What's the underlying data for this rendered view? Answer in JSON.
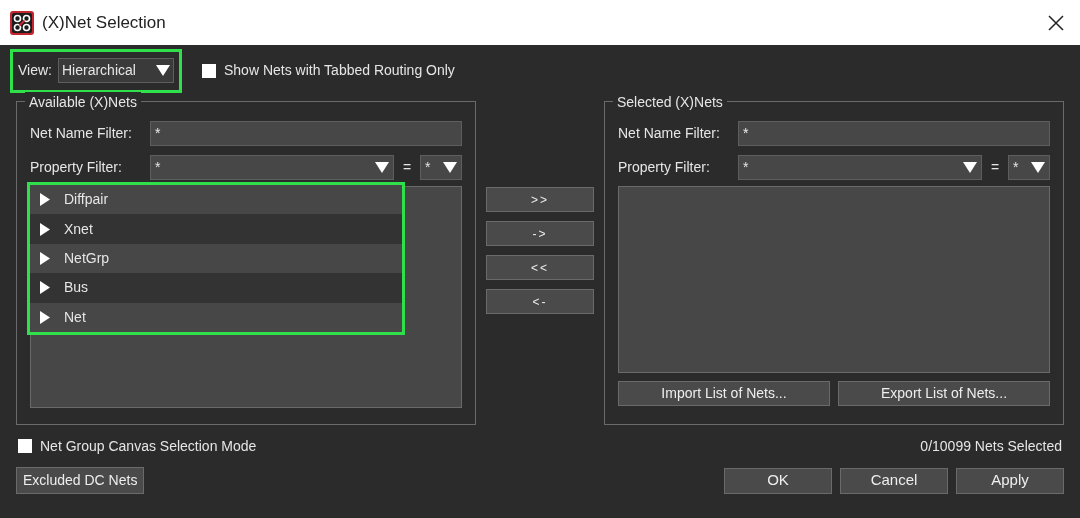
{
  "window": {
    "title": "(X)Net Selection"
  },
  "view": {
    "label": "View:",
    "value": "Hierarchical",
    "highlighted": true
  },
  "tabbed_only": {
    "label": "Show Nets with Tabbed Routing Only",
    "checked": false
  },
  "available": {
    "title": "Available (X)Nets",
    "name_filter": {
      "label": "Net Name Filter:",
      "value": "*"
    },
    "property_filter": {
      "label": "Property Filter:",
      "value": "*",
      "equals": "=",
      "value_2": "*"
    },
    "highlighted": true,
    "items": [
      {
        "label": "Diffpair",
        "expanded": false
      },
      {
        "label": "Xnet",
        "expanded": false
      },
      {
        "label": "NetGrp",
        "expanded": false
      },
      {
        "label": "Bus",
        "expanded": false
      },
      {
        "label": "Net",
        "expanded": false
      }
    ]
  },
  "transfer_buttons": [
    ">>",
    "->",
    "<<",
    "<-"
  ],
  "selected": {
    "title": "Selected (X)Nets",
    "name_filter": {
      "label": "Net Name Filter:",
      "value": "*"
    },
    "property_filter": {
      "label": "Property Filter:",
      "value": "*",
      "equals": "=",
      "value_2": "*"
    },
    "buttons": [
      "Import List of Nets...",
      "Export List of Nets..."
    ]
  },
  "canvas_mode": {
    "label": "Net Group Canvas Selection Mode",
    "checked": false
  },
  "count": "0/10099 Nets Selected",
  "excluded_button": "Excluded DC Nets",
  "buttons": [
    "OK",
    "Cancel",
    "Apply"
  ]
}
